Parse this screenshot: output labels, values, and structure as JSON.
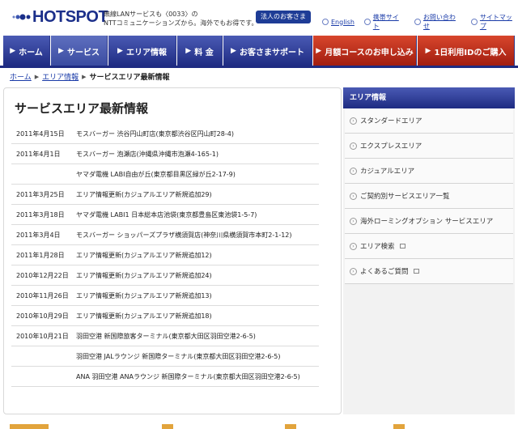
{
  "header": {
    "logo_text": "HOTSPOT",
    "tagline_line1": "無線LANサービスも〈0033〉の",
    "tagline_line2": "NTTコミュニケーションズから。海外でもお得です。",
    "corp_button": "法人のお客さま",
    "links": [
      "English",
      "携帯サイト",
      "お問い合わせ",
      "サイトマップ"
    ]
  },
  "nav": {
    "items": [
      "ホーム",
      "サービス",
      "エリア情報",
      "料 金",
      "お客さまサポート",
      "月額コースのお申し込み",
      "1日利用IDのご購入"
    ]
  },
  "breadcrumb": {
    "home": "ホーム",
    "area": "エリア情報",
    "current": "サービスエリア最新情報"
  },
  "main": {
    "title": "サービスエリア最新情報",
    "news": [
      {
        "date": "2011年4月15日",
        "text": "モスバーガー 渋谷円山町店(東京都渋谷区円山町28-4)"
      },
      {
        "date": "2011年4月1日",
        "text": "モスバーガー 泡瀬店(沖縄県沖縄市泡瀬4-165-1)"
      },
      {
        "date": "",
        "text": "ヤマダ電機 LABI自由が丘(東京都目黒区緑が丘2-17-9)"
      },
      {
        "date": "2011年3月25日",
        "text": "エリア情報更新(カジュアルエリア新規追加29)"
      },
      {
        "date": "2011年3月18日",
        "text": "ヤマダ電機 LABI1 日本総本店池袋(東京都豊島区東池袋1-5-7)"
      },
      {
        "date": "2011年3月4日",
        "text": "モスバーガー ショッパーズプラザ横須賀店(神奈川県横須賀市本町2-1-12)"
      },
      {
        "date": "2011年1月28日",
        "text": "エリア情報更新(カジュアルエリア新規追加12)"
      },
      {
        "date": "2010年12月22日",
        "text": "エリア情報更新(カジュアルエリア新規追加24)"
      },
      {
        "date": "2010年11月26日",
        "text": "エリア情報更新(カジュアルエリア新規追加13)"
      },
      {
        "date": "2010年10月29日",
        "text": "エリア情報更新(カジュアルエリア新規追加18)"
      },
      {
        "date": "2010年10月21日",
        "text": "羽田空港 新国際旅客ターミナル(東京都大田区羽田空港2-6-5)"
      },
      {
        "date": "",
        "text": "羽田空港 JALラウンジ 新国際ターミナル(東京都大田区羽田空港2-6-5)"
      },
      {
        "date": "",
        "text": "ANA 羽田空港 ANAラウンジ 新国際ターミナル(東京都大田区羽田空港2-6-5)"
      }
    ]
  },
  "sidebar": {
    "heading": "エリア情報",
    "items": [
      "スタンダードエリア",
      "エクスプレスエリア",
      "カジュアルエリア",
      "ご契約別サービスエリア一覧",
      "海外ローミングオプション サービスエリア",
      "エリア検索",
      "よくあるご質問"
    ]
  }
}
